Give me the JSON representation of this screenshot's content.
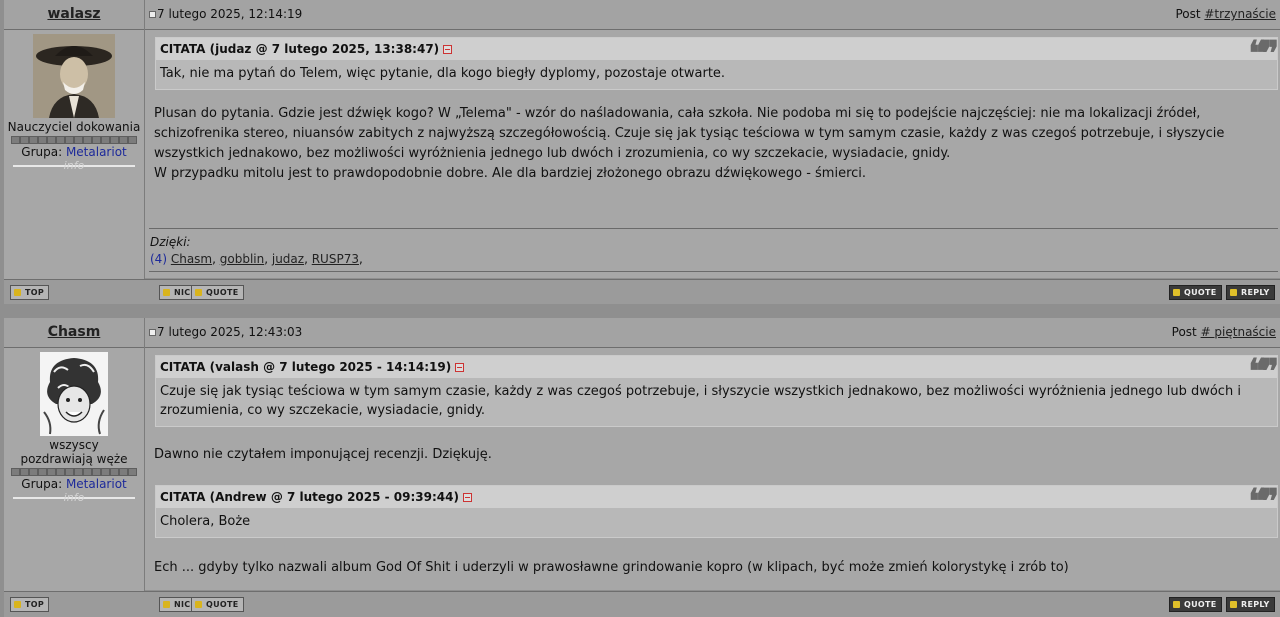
{
  "posts": [
    {
      "author": "walasz",
      "date": "7 lutego 2025, 12:14:19",
      "post_prefix": "Post ",
      "post_num": "#trzynaście",
      "rank": "Nauczyciel dokowania",
      "group_label": "Grupa: ",
      "group": "Metalariot",
      "info": "info",
      "quotes": [
        {
          "head": "CITATA (judaz @ 7 lutego 2025, 13:38:47)",
          "text": "Tak, nie ma pytań do Telem, więc pytanie, dla kogo biegły dyplomy, pozostaje otwarte."
        }
      ],
      "paragraph1": "Plusan do pytania. Gdzie jest dźwięk kogo? W „Telema\" - wzór do naśladowania, cała szkoła. Nie podoba mi się to podejście najczęściej: nie ma lokalizacji źródeł, schizofrenika stereo, niuansów zabitych z najwyższą szczegółowością. Czuje się jak tysiąc teściowa w tym samym czasie, każdy z was czegoś potrzebuje, i słyszycie wszystkich jednakowo, bez możliwości wyróżnienia jednego lub dwóch i zrozumienia, co wy szczekacie, wysiadacie, gnidy.",
      "paragraph2": "W przypadku mitolu jest to prawdopodobnie dobre. Ale dla bardziej złożonego obrazu dźwiękowego - śmierci.",
      "thanks_label": "Dzięki:",
      "thanks_count": "(4)",
      "thanks_users": [
        "Chasm",
        "gobblin",
        "judaz",
        "RUSP73"
      ],
      "buttons": {
        "top": "TOP",
        "nick": "NICK",
        "quote_small": "QUOTE",
        "quote": "QUOTE",
        "reply": "REPLY"
      }
    },
    {
      "author": "Chasm",
      "date": "7 lutego 2025, 12:43:03",
      "post_prefix": "Post ",
      "post_num": "# piętnaście",
      "rank": "wszyscy pozdrawiają węże",
      "group_label": "Grupa: ",
      "group": "Metalariot",
      "info": "info",
      "quote1": {
        "head": "CITATA (valash @ 7 lutego 2025 - 14:14:19)",
        "text": "Czuje się jak tysiąc teściowa w tym samym czasie, każdy z was czegoś potrzebuje, i słyszycie wszystkich jednakowo, bez możliwości wyróżnienia jednego lub dwóch i zrozumienia, co wy szczekacie, wysiadacie, gnidy."
      },
      "paragraph1": "Dawno nie czytałem imponującej recenzji. Dziękuję.",
      "quote2": {
        "head": "CITATA (Andrew @ 7 lutego 2025 - 09:39:44)",
        "text": "Cholera, Boże"
      },
      "paragraph2": "Ech ... gdyby tylko nazwali album God Of Shit i uderzyli w prawosławne grindowanie kopro (w klipach, być może zmień kolorystykę i zrób to)",
      "buttons": {
        "top": "TOP",
        "nick": "NICK",
        "quote_small": "QUOTE",
        "quote": "QUOTE",
        "reply": "REPLY"
      }
    }
  ]
}
